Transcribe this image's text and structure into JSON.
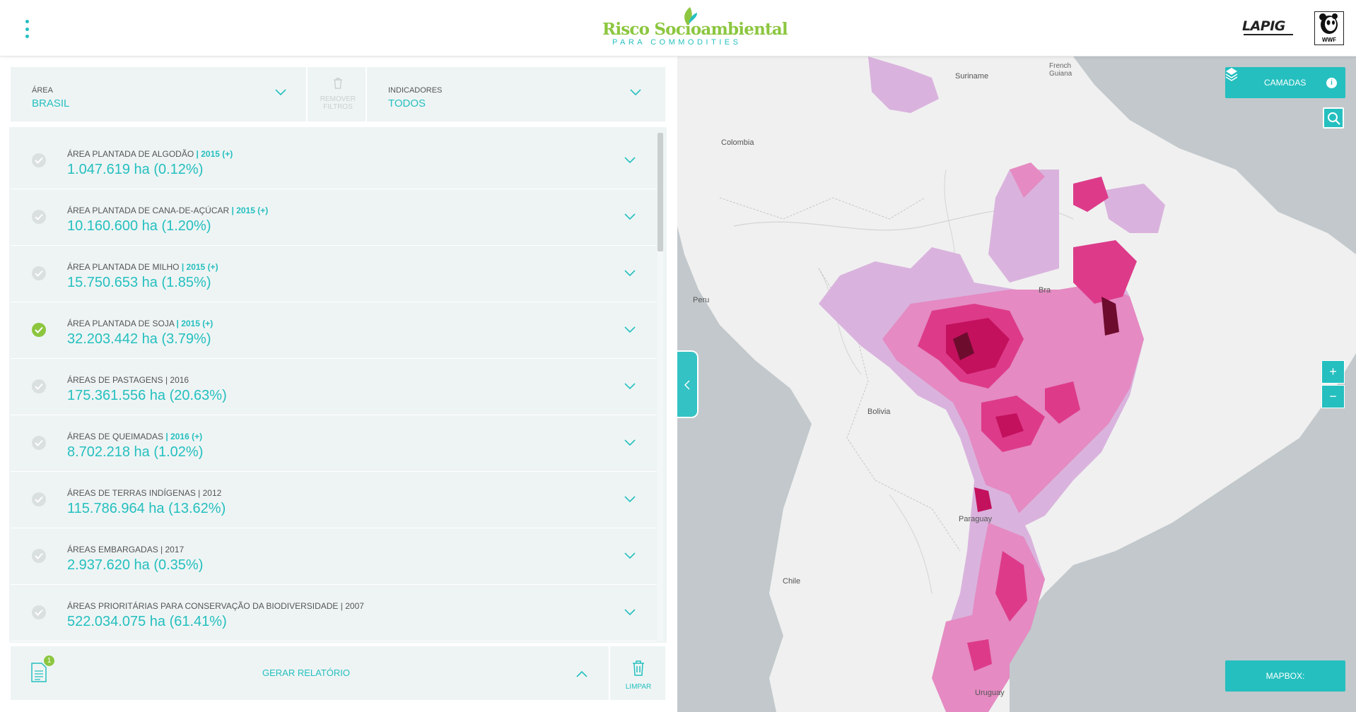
{
  "header": {
    "logo_title": "Risco Socioambiental",
    "logo_subtitle": "PARA COMMODITIES",
    "partner_logo_1": "LAPIG",
    "partner_logo_2": "WWF",
    "menu_icon": "vertical-dots-icon"
  },
  "filters": {
    "area_label": "ÁREA",
    "area_value": "BRASIL",
    "remove_label_line1": "REMOVER",
    "remove_label_line2": "FILTROS",
    "indicators_label": "INDICADORES",
    "indicators_value": "TODOS"
  },
  "indicators": [
    {
      "title": "ÁREA PLANTADA DE ALGODÃO",
      "year": "| 2015 (+)",
      "year_highlight": true,
      "value": "1.047.619 ha (0.12%)",
      "checked": false
    },
    {
      "title": "ÁREA PLANTADA DE CANA-DE-AÇÚCAR",
      "year": "| 2015 (+)",
      "year_highlight": true,
      "value": "10.160.600 ha (1.20%)",
      "checked": false
    },
    {
      "title": "ÁREA PLANTADA DE MILHO",
      "year": "| 2015 (+)",
      "year_highlight": true,
      "value": "15.750.653 ha (1.85%)",
      "checked": false
    },
    {
      "title": "ÁREA PLANTADA DE SOJA",
      "year": "| 2015 (+)",
      "year_highlight": true,
      "value": "32.203.442 ha (3.79%)",
      "checked": true
    },
    {
      "title": "ÁREAS DE PASTAGENS",
      "year": "| 2016",
      "year_highlight": false,
      "value": "175.361.556 ha (20.63%)",
      "checked": false
    },
    {
      "title": "ÁREAS DE QUEIMADAS",
      "year": "| 2016 (+)",
      "year_highlight": true,
      "value": "8.702.218 ha (1.02%)",
      "checked": false
    },
    {
      "title": "ÁREAS DE TERRAS INDÍGENAS",
      "year": "| 2012",
      "year_highlight": false,
      "value": "115.786.964 ha (13.62%)",
      "checked": false
    },
    {
      "title": "ÁREAS EMBARGADAS",
      "year": "| 2017",
      "year_highlight": false,
      "value": "2.937.620 ha (0.35%)",
      "checked": false
    },
    {
      "title": "ÁREAS PRIORITÁRIAS PARA CONSERVAÇÃO DA BIODIVERSIDADE",
      "year": "| 2007",
      "year_highlight": false,
      "value": "522.034.075 ha (61.41%)",
      "checked": false
    }
  ],
  "bottom": {
    "report_badge": "1",
    "report_label": "GERAR RELATÓRIO",
    "clear_label": "LIMPAR"
  },
  "map": {
    "layers_label": "CAMADAS",
    "info_glyph": "i",
    "zoom_in": "+",
    "zoom_out": "−",
    "mapbox_label": "MAPBOX:",
    "labels": {
      "colombia": "Colombia",
      "suriname": "Suriname",
      "guiana": "French Guiana",
      "peru": "Peru",
      "bolivia": "Bolivia",
      "paraguay": "Paraguay",
      "chile": "Chile",
      "uruguay": "Uruguay",
      "brazil": "Bra"
    },
    "colors": {
      "ocean": "#c2c8cb",
      "land": "#f0f0f0",
      "level_1": "#d9b3dd",
      "level_2": "#e58ac2",
      "level_3": "#dd3b8a",
      "level_4": "#c3115e",
      "level_5": "#6e0c2e"
    }
  },
  "colors": {
    "accent": "#25bfbf",
    "check_active": "#8cc63f",
    "panel_bg": "#eef4f4"
  }
}
